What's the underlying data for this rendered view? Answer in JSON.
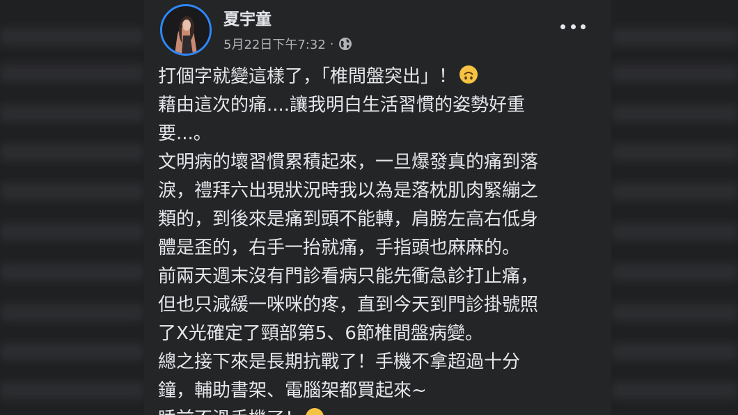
{
  "post": {
    "author": "夏宇童",
    "timestamp": "5月22日下午7:32",
    "separator": "·",
    "privacy_icon": "globe-icon",
    "more_icon": "more-options-icon",
    "lines": [
      "打個字就變這樣了，「椎間盤突出」！",
      "藉由這次的痛....讓我明白生活習慣的姿勢好重",
      "要...。",
      "文明病的壞習慣累積起來，一旦爆發真的痛到落",
      "淚，禮拜六出現狀況時我以為是落枕肌肉緊繃之",
      "類的，到後來是痛到頭不能轉，肩膀左高右低身",
      "體是歪的，右手一抬就痛，手指頭也麻麻的。",
      "前兩天週末沒有門診看病只能先衝急診打止痛，",
      "但也只減緩一咪咪的疼，直到今天到門診掛號照",
      "了X光確定了頸部第5、6節椎間盤病變。",
      "總之接下來是長期抗戰了！手機不拿超過十分",
      "鐘，輔助書架、電腦架都買起來~",
      "睡前不滑手機了！"
    ],
    "emoji_1": "upside-down-face-emoji",
    "emoji_2": "crying-face-emoji"
  },
  "colors": {
    "post_background": "#242526",
    "text": "#e4e6eb",
    "secondary_text": "#b0b3b8",
    "avatar_ring": "#2d88ff",
    "emoji": "#f6c244"
  }
}
